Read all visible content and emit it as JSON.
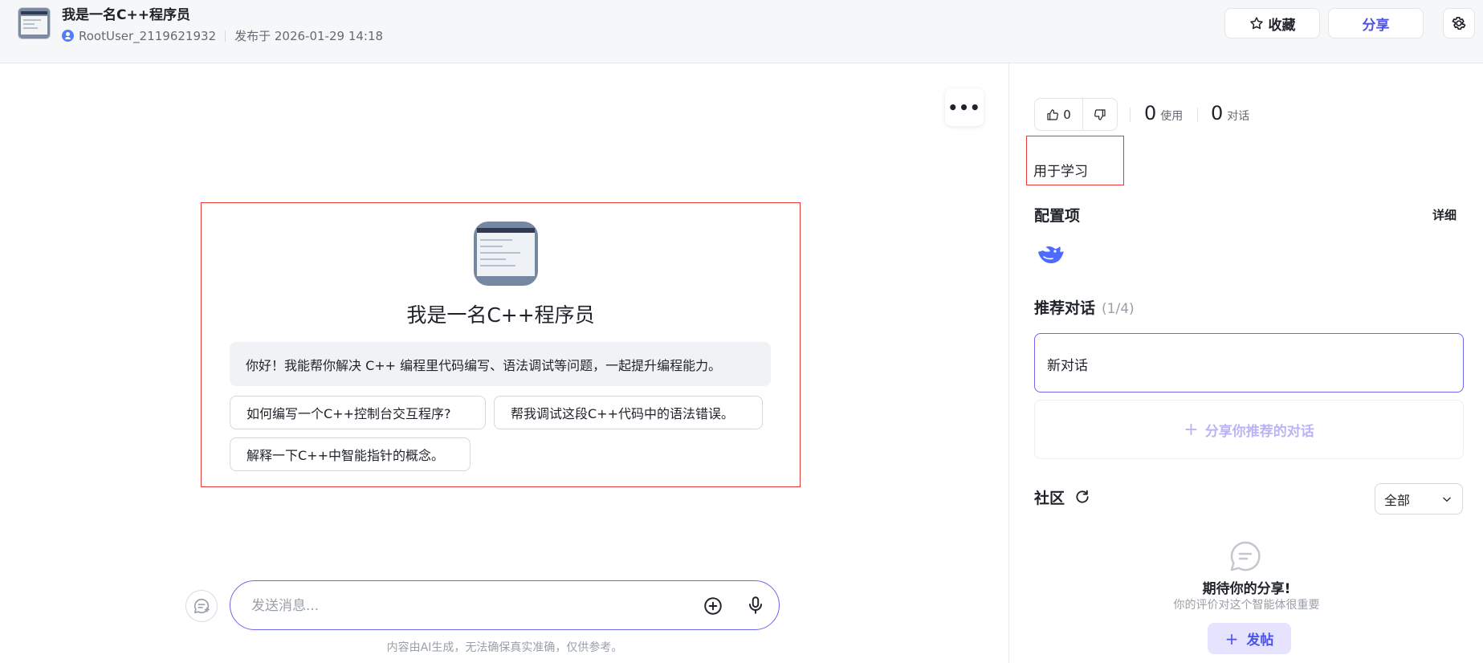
{
  "header": {
    "title": "我是一名C++程序员",
    "author": "RootUser_2119621932",
    "published": "发布于 2026-01-29 14:18",
    "collect_label": "收藏",
    "share_label": "分享"
  },
  "chat": {
    "bot_name": "我是一名C++程序员",
    "greeting": "你好！我能帮你解决 C++ 编程里代码编写、语法调试等问题，一起提升编程能力。",
    "suggestions": [
      "如何编写一个C++控制台交互程序?",
      "帮我调试这段C++代码中的语法错误。",
      "解释一下C++中智能指针的概念。"
    ],
    "input_placeholder": "发送消息...",
    "disclaimer": "内容由AI生成，无法确保真实准确，仅供参考。",
    "more_label": "•••"
  },
  "panel": {
    "likes": "0",
    "uses_count": "0",
    "uses_label": "使用",
    "chats_count": "0",
    "chats_label": "对话",
    "description": "用于学习",
    "config_title": "配置项",
    "detail_label": "详细",
    "model_icon": "deepseek-whale-icon",
    "recommended_title": "推荐对话",
    "recommended_count": "(1/4)",
    "new_conversation": "新对话",
    "share_recommended": "分享你推荐的对话",
    "community_title": "社区",
    "filter_value": "全部",
    "empty_title": "期待你的分享!",
    "empty_subtitle": "你的评价对这个智能体很重要",
    "post_label": "发帖"
  },
  "colors": {
    "accent": "#4d53e8",
    "input_border": "#6f65f2",
    "highlight_border": "#e53935"
  }
}
